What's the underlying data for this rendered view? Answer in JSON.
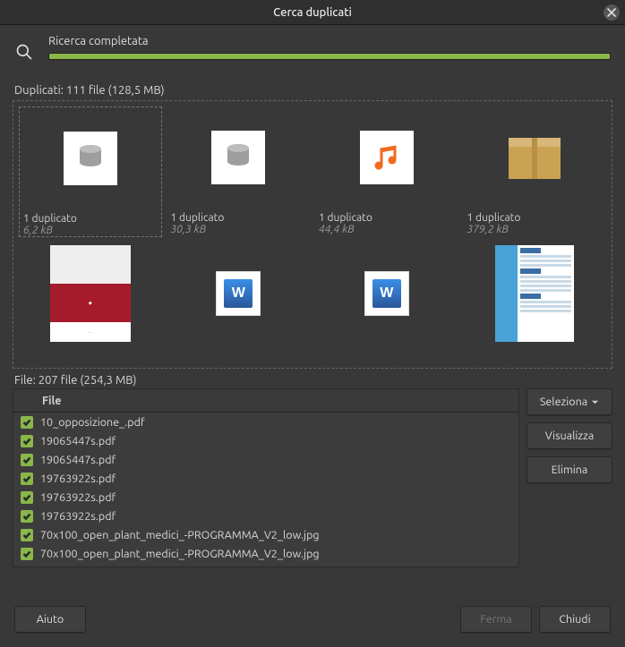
{
  "window": {
    "title": "Cerca duplicati"
  },
  "search": {
    "status": "Ricerca completata",
    "progress_pct": 100
  },
  "duplicates": {
    "label": "Duplicati: 111 file (128,5 MB)",
    "items": [
      {
        "caption": "1 duplicato",
        "sub": "6,2 kB",
        "icon": "database"
      },
      {
        "caption": "1 duplicato",
        "sub": "30,3 kB",
        "icon": "database"
      },
      {
        "caption": "1 duplicato",
        "sub": "44,4 kB",
        "icon": "music"
      },
      {
        "caption": "1 duplicato",
        "sub": "379,2 kB",
        "icon": "package"
      },
      {
        "caption": "",
        "sub": "",
        "icon": "doc-red"
      },
      {
        "caption": "",
        "sub": "",
        "icon": "word"
      },
      {
        "caption": "",
        "sub": "",
        "icon": "word"
      },
      {
        "caption": "",
        "sub": "",
        "icon": "doc-cv"
      }
    ]
  },
  "files": {
    "label": "File: 207 file (254,3 MB)",
    "column_header": "File",
    "rows": [
      {
        "checked": true,
        "name": "10_opposizione_.pdf"
      },
      {
        "checked": true,
        "name": "19065447s.pdf"
      },
      {
        "checked": true,
        "name": "19065447s.pdf"
      },
      {
        "checked": true,
        "name": "19763922s.pdf"
      },
      {
        "checked": true,
        "name": "19763922s.pdf"
      },
      {
        "checked": true,
        "name": "19763922s.pdf"
      },
      {
        "checked": true,
        "name": "70x100_open_plant_medici_-PROGRAMMA_V2_low.jpg"
      },
      {
        "checked": true,
        "name": "70x100_open_plant_medici_-PROGRAMMA_V2_low.jpg"
      }
    ]
  },
  "side_buttons": {
    "select": "Seleziona",
    "view": "Visualizza",
    "delete": "Elimina"
  },
  "footer": {
    "help": "Aiuto",
    "stop": "Ferma",
    "close": "Chiudi"
  }
}
